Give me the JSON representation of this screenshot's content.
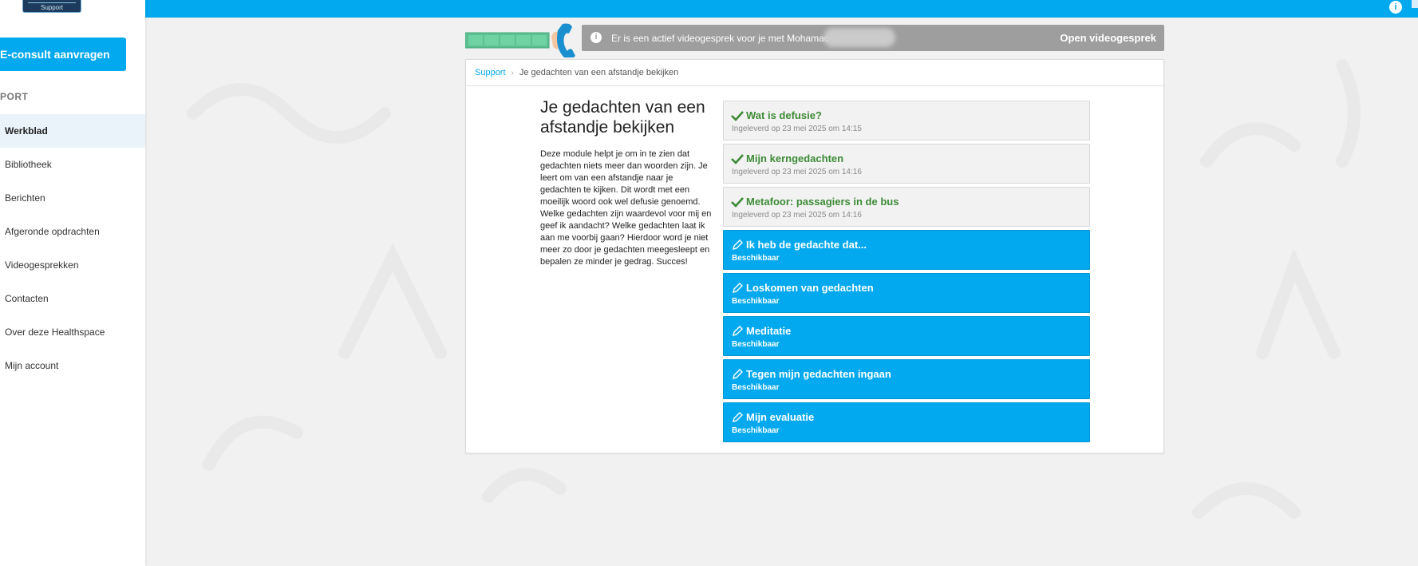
{
  "sidebar": {
    "logo_text": "Support",
    "econsult_label": "E-consult aanvragen",
    "section_label": "PORT",
    "items": [
      {
        "label": "Werkblad",
        "active": true
      },
      {
        "label": "Bibliotheek",
        "active": false
      },
      {
        "label": "Berichten",
        "active": false
      },
      {
        "label": "Afgeronde opdrachten",
        "active": false
      },
      {
        "label": "Videogesprekken",
        "active": false
      },
      {
        "label": "Contacten",
        "active": false
      },
      {
        "label": "Over deze Healthspace",
        "active": false
      },
      {
        "label": "Mijn account",
        "active": false
      }
    ]
  },
  "banner": {
    "text": "Er is een actief videogesprek voor je met Mohamac",
    "open_label": "Open videogesprek"
  },
  "breadcrumb": {
    "root": "Support",
    "current": "Je gedachten van een afstandje bekijken"
  },
  "module": {
    "title": "Je gedachten van een afstandje bekijken",
    "description": "Deze module helpt je om in te zien dat gedachten niets meer dan woorden zijn. Je leert om van een afstandje naar je gedachten te kijken. Dit wordt met een moeilijk woord ook wel defusie genoemd. Welke gedachten zijn waardevol voor mij en geef ik aandacht? Welke gedachten laat ik aan me voorbij gaan? Hierdoor word je niet meer zo door je gedachten meegesleept en bepalen ze minder je gedrag. Succes!"
  },
  "tasks": [
    {
      "title": "Wat is defusie?",
      "status": "Ingeleverd op 23 mei 2025 om 14:15",
      "done": true
    },
    {
      "title": "Mijn kerngedachten",
      "status": "Ingeleverd op 23 mei 2025 om 14:16",
      "done": true
    },
    {
      "title": "Metafoor: passagiers in de bus",
      "status": "Ingeleverd op 23 mei 2025 om 14:16",
      "done": true
    },
    {
      "title": "Ik heb de gedachte dat...",
      "status": "Beschikbaar",
      "done": false
    },
    {
      "title": "Loskomen van gedachten",
      "status": "Beschikbaar",
      "done": false
    },
    {
      "title": "Meditatie",
      "status": "Beschikbaar",
      "done": false
    },
    {
      "title": "Tegen mijn gedachten ingaan",
      "status": "Beschikbaar",
      "done": false
    },
    {
      "title": "Mijn evaluatie",
      "status": "Beschikbaar",
      "done": false
    }
  ],
  "colors": {
    "accent": "#03a9ee",
    "done_green": "#3d8b37",
    "banner_grey": "#9e9e9e"
  },
  "icons": {
    "done": "check-icon",
    "open": "pencil-icon",
    "info": "info-icon"
  }
}
